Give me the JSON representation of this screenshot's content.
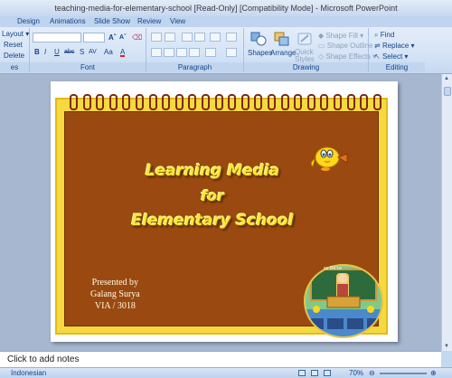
{
  "window": {
    "title": "teaching-media-for-elementary-school [Read-Only] [Compatibility Mode] - Microsoft PowerPoint"
  },
  "ribbon_tabs": [
    "Design",
    "Animations",
    "Slide Show",
    "Review",
    "View"
  ],
  "ribbon": {
    "slides": {
      "layout": "Layout",
      "reset": "Reset",
      "delete": "Delete",
      "label": "es"
    },
    "font": {
      "label": "Font",
      "bold": "B",
      "italic": "I",
      "underline": "U",
      "strike": "abc",
      "shadow": "S",
      "spacing": "AV",
      "case": "Aa",
      "color": "A",
      "grow": "A",
      "shrink": "A"
    },
    "paragraph": {
      "label": "Paragraph"
    },
    "drawing": {
      "label": "Drawing",
      "shapes": "Shapes",
      "arrange": "Arrange",
      "quick_styles": "Quick Styles",
      "shape_fill": "Shape Fill",
      "shape_outline": "Shape Outline",
      "shape_effects": "Shape Effects"
    },
    "editing": {
      "label": "Editing",
      "find": "Find",
      "replace": "Replace",
      "select": "Select"
    }
  },
  "slide": {
    "title_line1": "Learning Media",
    "title_line2": "for",
    "title_line3": "Elementary School",
    "presented_by": "Presented by",
    "author": "Galang Surya",
    "class": "VIA / 3018",
    "board_text": "ec Da Le"
  },
  "notes": {
    "placeholder": "Click to add notes"
  },
  "status": {
    "language": "Indonesian",
    "zoom": "70%"
  },
  "colors": {
    "slide_brown": "#9a4a10",
    "slide_yellow": "#f6d840",
    "title_yellow": "#ffe53a"
  }
}
